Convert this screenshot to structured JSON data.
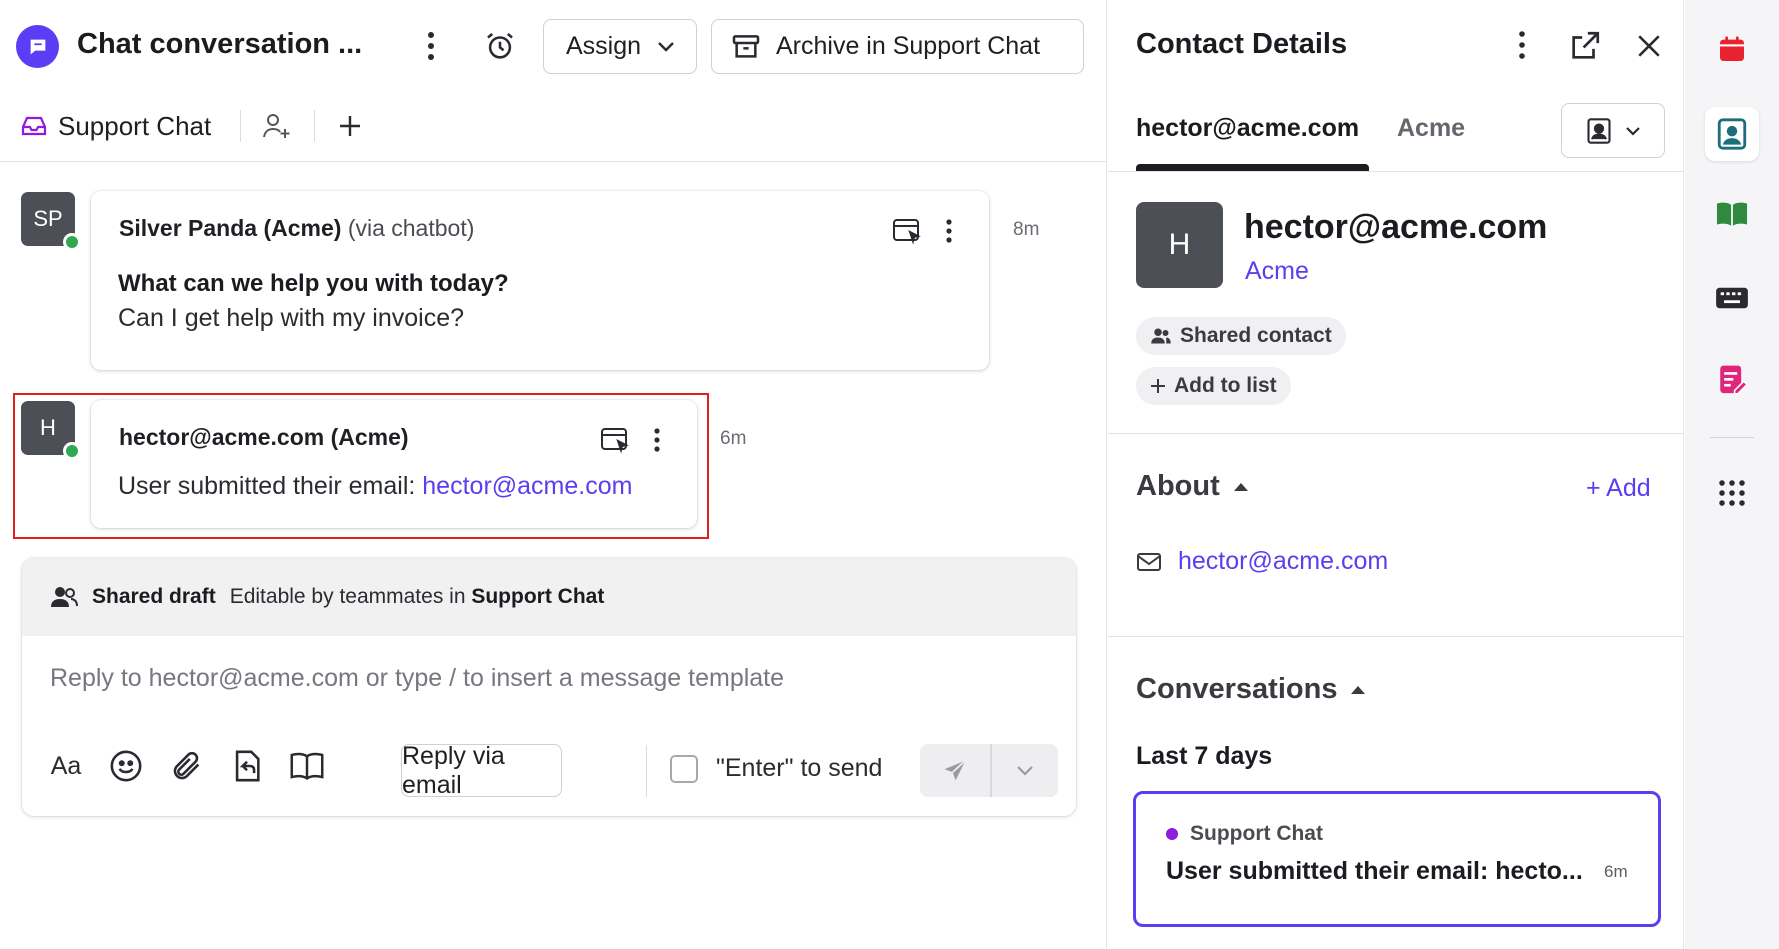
{
  "conversation": {
    "title": "Chat conversation ...",
    "assign_label": "Assign",
    "archive_label": "Archive in Support Chat",
    "inbox_name": "Support Chat"
  },
  "messages": [
    {
      "avatar_initials": "SP",
      "sender": "Silver Panda (Acme)",
      "via": "(via chatbot)",
      "question": "What can we help you with today?",
      "body": "Can I get help with my invoice?",
      "time": "8m"
    },
    {
      "avatar_initials": "H",
      "sender": "hector@acme.com (Acme)",
      "body_prefix": "User submitted their email: ",
      "body_link": "hector@acme.com",
      "time": "6m"
    }
  ],
  "composer": {
    "draft_label": "Shared draft",
    "draft_note_prefix": "Editable by teammates in",
    "draft_inbox": "Support Chat",
    "placeholder": "Reply to hector@acme.com or type / to insert a message template",
    "format_label": "Aa",
    "reply_via_email": "Reply via email",
    "enter_to_send": "\"Enter\" to send"
  },
  "contact": {
    "panel_title": "Contact Details",
    "tabs": [
      {
        "label": "hector@acme.com",
        "active": true
      },
      {
        "label": "Acme",
        "active": false
      }
    ],
    "avatar_initial": "H",
    "name": "hector@acme.com",
    "company": "Acme",
    "shared_chip": "Shared contact",
    "add_to_list": "Add to list",
    "about_title": "About",
    "about_add": "+ Add",
    "about_email": "hector@acme.com",
    "conversations_title": "Conversations",
    "last_7_days": "Last 7 days",
    "recent_conversation": {
      "inbox": "Support Chat",
      "preview": "User submitted their email: hecto...",
      "time": "6m"
    }
  },
  "rail": {
    "items": [
      "calendar-icon",
      "contact-card-icon",
      "book-icon",
      "keyboard-icon",
      "form-edit-icon",
      "apps-grid-icon"
    ],
    "active": "contact-card-icon"
  },
  "colors": {
    "accent": "#5a3ff0",
    "online": "#2fa84f",
    "highlight": "#e0201f",
    "calendar": "#e8232f",
    "contacts": "#1c6f7a",
    "book": "#2f8a3e",
    "form": "#e0267a"
  }
}
